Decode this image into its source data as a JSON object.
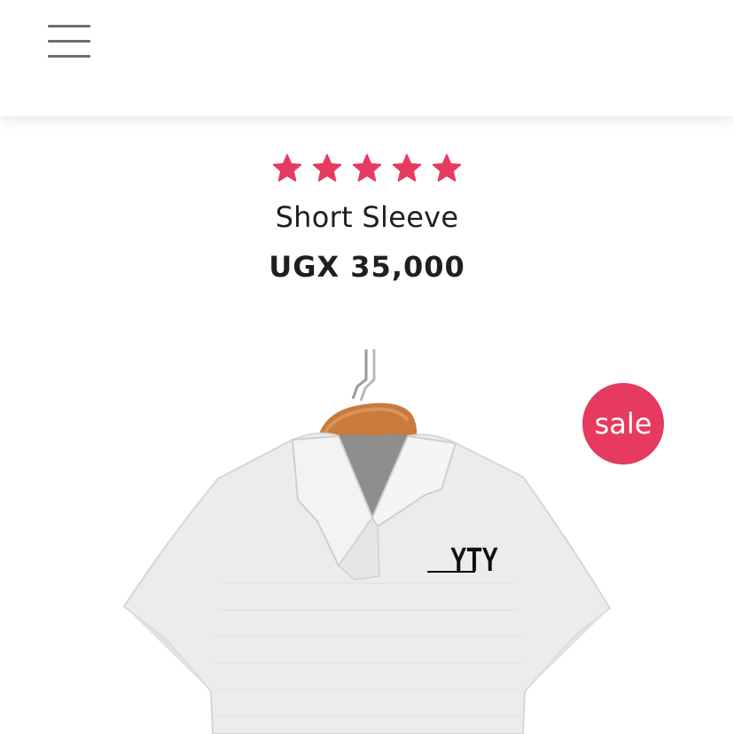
{
  "header": {
    "menu_icon": "hamburger-menu-icon"
  },
  "product": {
    "rating": 5,
    "rating_max": 5,
    "star_color": "#e63a5f",
    "title": "Short Sleeve",
    "price": "UGX 35,000",
    "badge": "sale",
    "badge_color": "#e63a5f",
    "shirt_logo": "YTY"
  }
}
